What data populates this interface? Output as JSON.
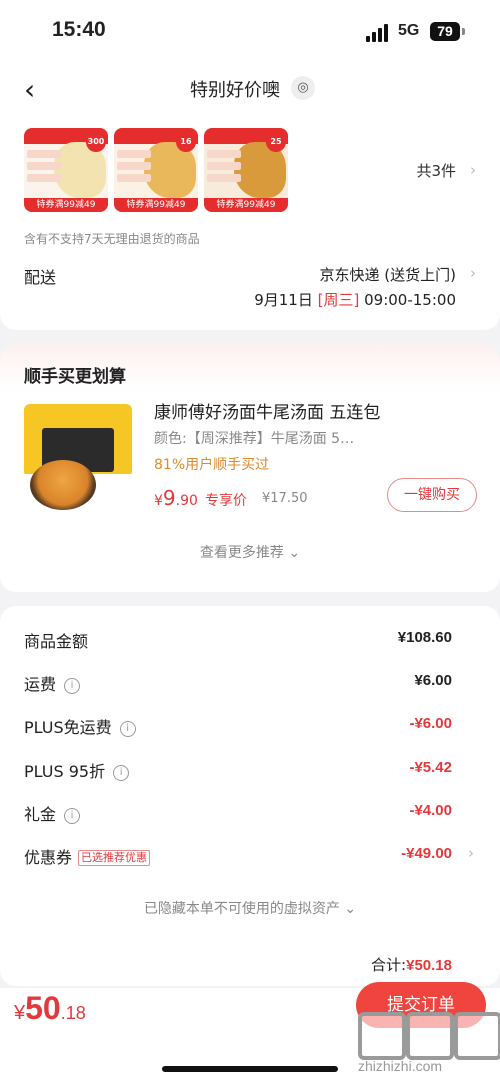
{
  "status_bar": {
    "time": "15:40",
    "network": "5G",
    "battery": "79"
  },
  "header": {
    "title": "特别好价噢",
    "back_icon": "chevron-left-icon",
    "location_icon": "location-pin-icon"
  },
  "products": {
    "thumbnails": [
      {
        "name": "product-1",
        "badge": "300",
        "coupon": "特券满99减49",
        "colors": {
          "food": "#f2e3b0"
        }
      },
      {
        "name": "product-2",
        "badge": "16",
        "coupon": "特券满99减49",
        "colors": {
          "food": "#e8b85a"
        }
      },
      {
        "name": "product-3",
        "badge": "25",
        "coupon": "特券满99减49",
        "colors": {
          "food": "#d99a3c"
        }
      }
    ],
    "count_text": "共3件",
    "return_note": "含有不支持7天无理由退货的商品"
  },
  "delivery": {
    "label": "配送",
    "method": "京东快递 (送货上门)",
    "date": "9月11日",
    "weekday": "[周三]",
    "time_range": "09:00-15:00"
  },
  "recommendation": {
    "section_title": "顺手买更划算",
    "product_name": "康师傅好汤面牛尾汤面 五连包",
    "variant": "颜色:【周深推荐】牛尾汤面 5…",
    "buyers_note": "81%用户顺手买过",
    "price_currency": "¥",
    "price_int": "9",
    "price_dec": ".90",
    "price_label": "专享价",
    "original_price": "¥17.50",
    "buy_button": "一键购买",
    "more_link": "查看更多推荐 ⌄"
  },
  "summary": {
    "rows": [
      {
        "label": "商品金额",
        "value": "¥108.60",
        "red": false,
        "info": false
      },
      {
        "label": "运费",
        "value": "¥6.00",
        "red": false,
        "info": true
      },
      {
        "label": "PLUS免运费",
        "value": "-¥6.00",
        "red": true,
        "info": true
      },
      {
        "label": "PLUS 95折",
        "value": "-¥5.42",
        "red": true,
        "info": true
      },
      {
        "label": "礼金",
        "value": "-¥4.00",
        "red": true,
        "info": true
      },
      {
        "label": "优惠券",
        "value": "-¥49.00",
        "red": true,
        "info": false,
        "tag": "已选推荐优惠"
      }
    ],
    "hidden_assets": "已隐藏本单不可使用的虚拟资产 ⌄",
    "total_label": "合计:",
    "total_value": "¥50.18"
  },
  "footer": {
    "pay_currency": "¥",
    "pay_int": "50",
    "pay_dec": ".18",
    "submit_button": "提交订单",
    "watermark": "zhizhizhi.com"
  },
  "colors": {
    "accent": "#e4393c",
    "button": "#f0453f",
    "background": "#f3f3f5"
  }
}
